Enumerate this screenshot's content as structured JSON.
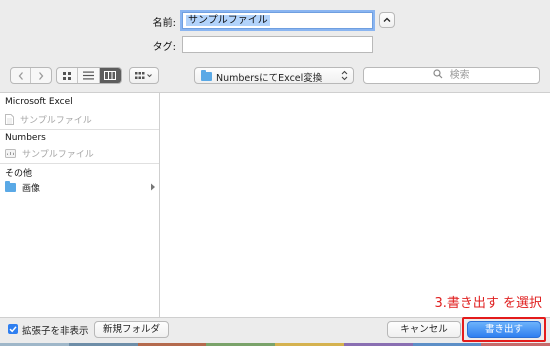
{
  "dialog": {
    "name_label": "名前:",
    "name_value": "サンプルファイル",
    "tags_label": "タグ:",
    "tags_value": ""
  },
  "toolbar": {
    "back_icon": "chevron-left-icon",
    "forward_icon": "chevron-right-icon",
    "location": "NumbersにてExcel変換",
    "search_placeholder": "検索"
  },
  "sidebar": {
    "sections": [
      {
        "title": "Microsoft Excel",
        "items": [
          {
            "label": "サンプルファイル",
            "icon": "document-icon",
            "dimmed": true
          }
        ]
      },
      {
        "title": "Numbers",
        "items": [
          {
            "label": "サンプルファイル",
            "icon": "numbers-file-icon",
            "dimmed": true
          }
        ]
      },
      {
        "title": "その他",
        "items": [
          {
            "label": "画像",
            "icon": "folder-icon",
            "dimmed": false
          }
        ]
      }
    ]
  },
  "footer": {
    "hide_extension_label": "拡張子を非表示",
    "hide_extension_checked": true,
    "new_folder_label": "新規フォルダ",
    "cancel_label": "キャンセル",
    "save_label": "書き出す",
    "annotation": "3.書き出す を選択"
  },
  "colors": {
    "accent": "#2f7ff0",
    "annotation": "#e02020",
    "folder": "#5aa9e6"
  }
}
